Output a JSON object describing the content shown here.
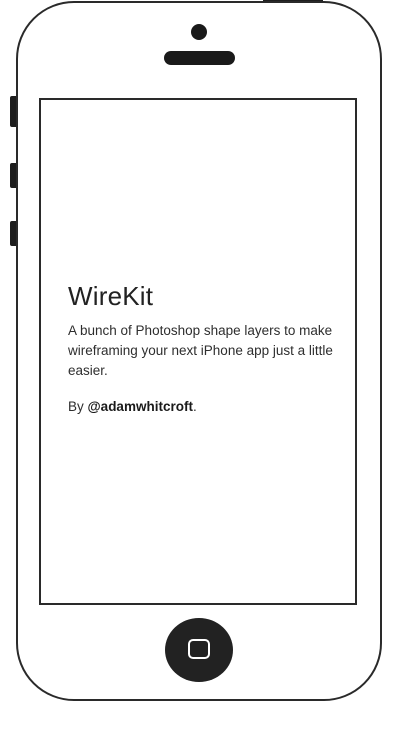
{
  "app": {
    "title": "WireKit",
    "description": "A bunch of Photoshop shape layers to make wireframing your next iPhone app just a little easier.",
    "byline_prefix": "By ",
    "author_handle": "@adamwhitcroft",
    "byline_suffix": "."
  },
  "device": {
    "type": "iPhone wireframe",
    "outline_color": "#2a2a2a",
    "fill_color": "#ffffff",
    "icons": {
      "camera": "camera-icon",
      "speaker": "speaker-icon",
      "home": "home-square-icon"
    }
  }
}
